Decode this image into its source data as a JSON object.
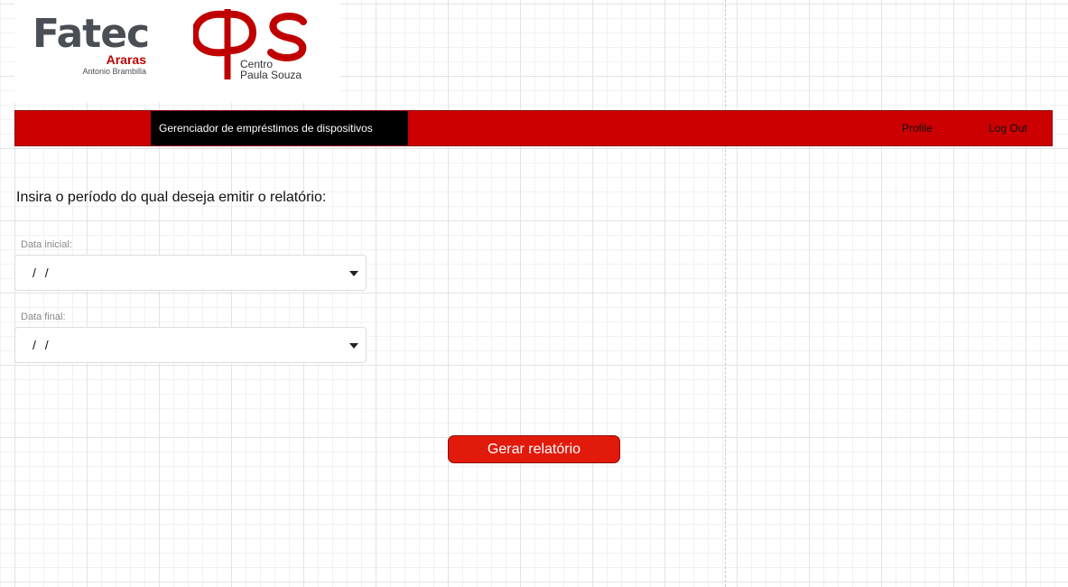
{
  "logos": {
    "fatec": {
      "name": "Fatec",
      "city": "Araras",
      "subtitle": "Antonio Brambilla"
    },
    "cps": {
      "line1": "Centro",
      "line2": "Paula Souza"
    }
  },
  "navbar": {
    "title": "Gerenciador de empréstimos de dispositivos",
    "links": [
      {
        "label": "Profile"
      },
      {
        "label": "Log Out"
      }
    ]
  },
  "form": {
    "instruction": "Insira o período do qual deseja emitir o relatório:",
    "start_date": {
      "label": "Data inicial:",
      "value": "/ /"
    },
    "end_date": {
      "label": "Data final:",
      "value": "/ /"
    },
    "submit_label": "Gerar relatório"
  },
  "colors": {
    "navbar_background": "#cc0000",
    "navbar_title_background": "#000000",
    "button_background": "#e21a0c",
    "brand_red": "#c00000",
    "fatec_gray": "#4a4f55"
  }
}
